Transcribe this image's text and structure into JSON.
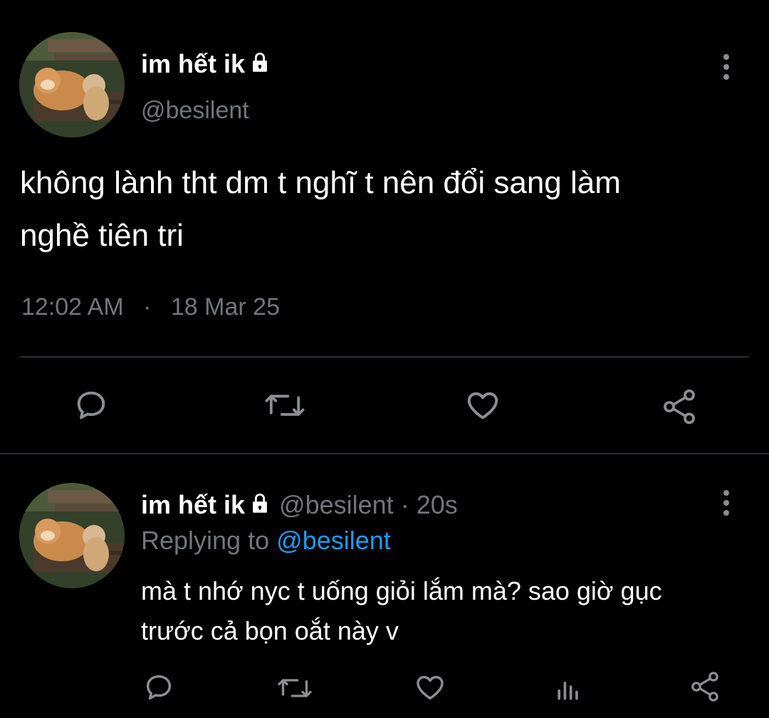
{
  "main_tweet": {
    "display_name": "im hết ik",
    "handle": "@besilent",
    "text_line1": "không lành tht dm t nghĩ t nên đổi sang làm",
    "text_line2": "nghề tiên tri",
    "time": "12:02 AM",
    "separator": "·",
    "date": "18 Mar 25"
  },
  "reply": {
    "display_name": "im hết ik",
    "handle": "@besilent",
    "separator": "·",
    "age": "20s",
    "replying_prefix": "Replying to",
    "replying_handle": "@besilent",
    "text_line1": "mà t nhớ nyc t uống giỏi lắm mà? sao giờ gục",
    "text_line2": "trước cả bọn oắt này v"
  },
  "icons": {
    "lock": "lock-icon",
    "more": "more-vertical-icon",
    "reply": "reply-icon",
    "retweet": "retweet-icon",
    "like": "heart-icon",
    "share": "share-icon",
    "views": "views-icon"
  },
  "colors": {
    "background": "#000000",
    "text": "#ffffff",
    "muted": "#71767b",
    "link": "#1d9bf0"
  }
}
